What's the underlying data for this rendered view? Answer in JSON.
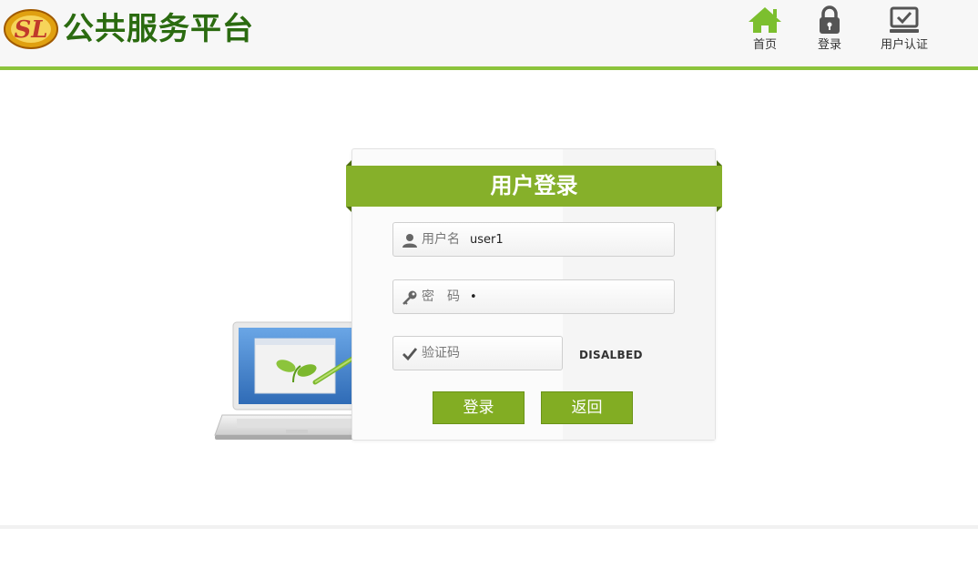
{
  "header": {
    "site_title": "公共服务平台",
    "logo_text": "SL",
    "accent_color": "#8cc43c",
    "title_color": "#2b6b10",
    "nav": [
      {
        "label": "首页",
        "icon": "home-icon"
      },
      {
        "label": "登录",
        "icon": "lock-icon"
      },
      {
        "label": "用户认证",
        "icon": "monitor-check-icon"
      }
    ]
  },
  "login": {
    "title": "用户登录",
    "brand_green": "#86b02a",
    "username": {
      "label": "用户名",
      "value": "user1",
      "icon": "user-icon"
    },
    "password": {
      "label": "密　码",
      "value": "•",
      "icon": "key-icon"
    },
    "captcha": {
      "label": "验证码",
      "value": "",
      "icon": "check-icon",
      "image_text": "DISALBED"
    },
    "buttons": {
      "login": "登录",
      "back": "返回"
    }
  },
  "illustration": {
    "icon": "laptop-sprout-icon"
  }
}
